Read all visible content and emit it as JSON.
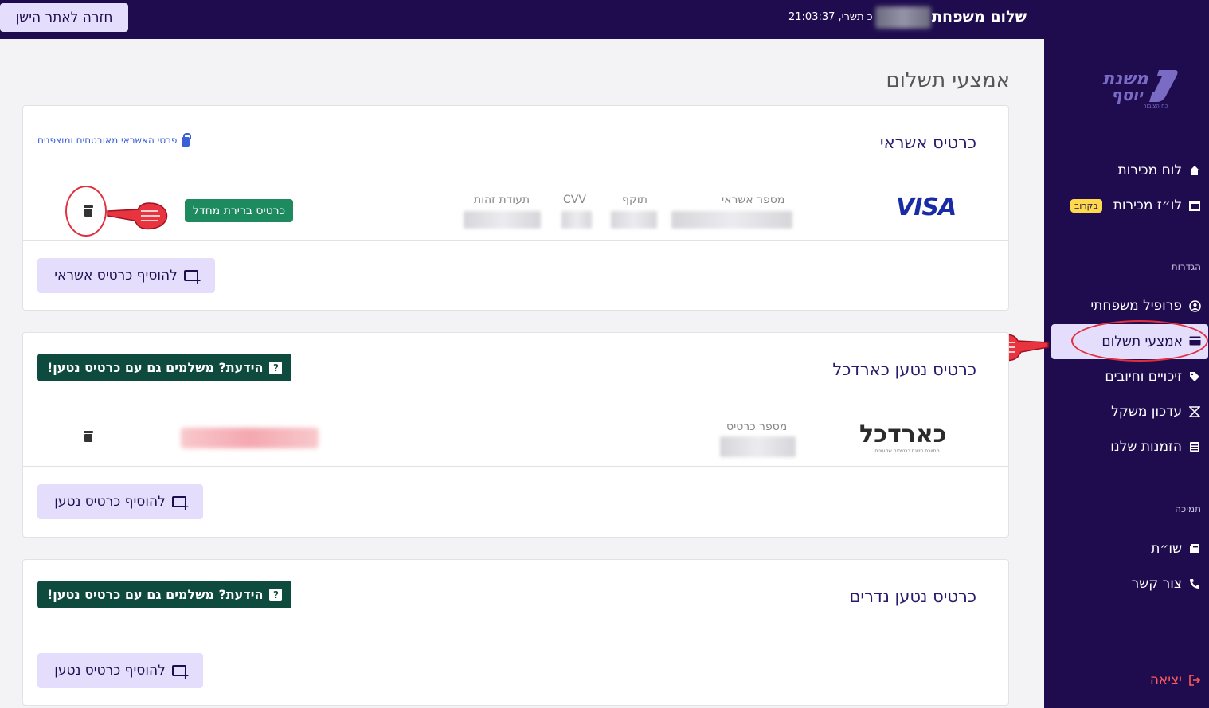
{
  "topbar": {
    "back_label": "חזרה לאתר הישן",
    "greeting": "שלום משפחת",
    "datetime": "21:03:37 ,כ תשרי"
  },
  "sidebar": {
    "logo_alt": "משנת יוסף",
    "logo_sub": "כח הציבור",
    "items": [
      {
        "label": "לוח מכירות",
        "icon": "home-icon"
      },
      {
        "label": "לו״ז מכירות",
        "icon": "calendar-icon",
        "badge": "בקרוב"
      }
    ],
    "settings_title": "הגדרות",
    "settings_items": [
      {
        "label": "פרופיל משפחתי",
        "icon": "user-circle-icon"
      },
      {
        "label": "אמצעי תשלום",
        "icon": "credit-card-icon",
        "active": true
      },
      {
        "label": "זיכויים וחיובים",
        "icon": "tag-icon"
      },
      {
        "label": "עדכון משקל",
        "icon": "scale-icon"
      },
      {
        "label": "הזמנות שלנו",
        "icon": "list-icon"
      }
    ],
    "support_title": "תמיכה",
    "support_items": [
      {
        "label": "שו״ת",
        "icon": "book-icon"
      },
      {
        "label": "צור קשר",
        "icon": "phone-icon"
      }
    ],
    "logout_label": "יציאה"
  },
  "page": {
    "title": "אמצעי תשלום"
  },
  "credit_card": {
    "title": "כרטיס אשראי",
    "secure_note": "פרטי האשראי מאובטחים ומוצפנים",
    "brand": "VISA",
    "label_number": "מספר אשראי",
    "label_expiry": "תוקף",
    "label_cvv": "CVV",
    "label_id": "תעודת זהות",
    "default_badge": "כרטיס ברירת מחדל",
    "add_button": "להוסיף כרטיס אשראי"
  },
  "cardcal": {
    "title": "כרטיס נטען כארדכל",
    "dyk": "הידעת? משלמים גם עם כרטיס נטען!",
    "logo_text": "כארדכל",
    "logo_sub": "מתווכת משגת כרטיסים שמעונים",
    "label_number": "מספר כרטיס",
    "add_button": "להוסיף כרטיס נטען"
  },
  "nedarim": {
    "title": "כרטיס נטען נדרים",
    "dyk": "הידעת? משלמים גם עם כרטיס נטען!",
    "add_button": "להוסיף כרטיס נטען"
  }
}
